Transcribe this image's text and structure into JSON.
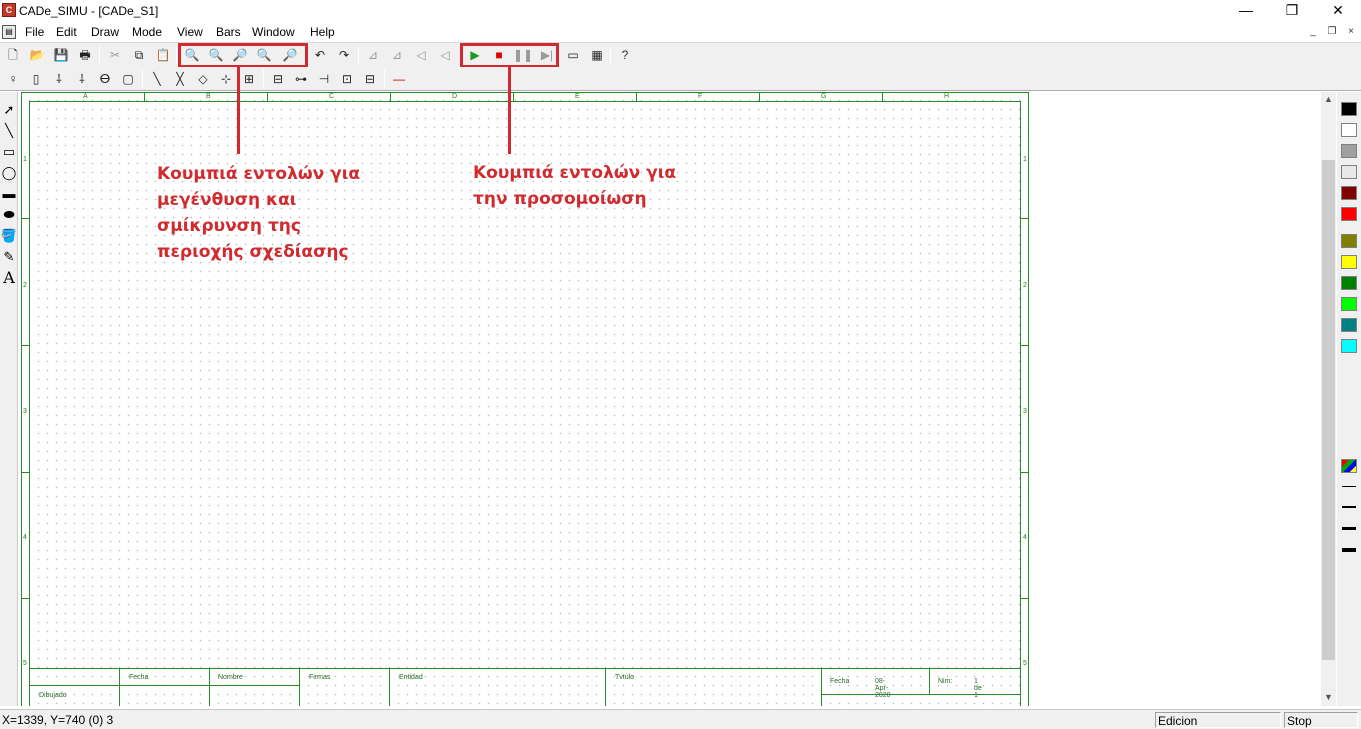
{
  "window": {
    "title": "CADe_SIMU - [CADe_S1]",
    "controls": {
      "minimize": "—",
      "maximize": "❐",
      "close": "✕"
    }
  },
  "menu": {
    "items": [
      "File",
      "Edit",
      "Draw",
      "Mode",
      "View",
      "Bars",
      "Window",
      "Help"
    ],
    "mdi_controls": [
      "_",
      "❐",
      "×"
    ]
  },
  "toolbar_main": {
    "file_buttons": [
      "new-icon",
      "open-icon",
      "save-icon",
      "print-icon"
    ],
    "edit_buttons": [
      "cut-icon",
      "copy-icon",
      "paste-icon"
    ],
    "zoom_buttons": [
      "zoom-in-icon",
      "zoom-out-icon",
      "zoom-window-icon",
      "zoom-all-icon",
      "zoom-previous-icon"
    ],
    "undo_buttons": [
      "undo-icon",
      "redo-icon"
    ],
    "transform_buttons": [
      "rotate-left-icon",
      "rotate-right-icon",
      "mirror-icon",
      "align-icon"
    ],
    "simulation_buttons": [
      "play-icon",
      "stop-icon",
      "pause-icon",
      "step-icon"
    ],
    "extra_buttons": [
      "window-icon",
      "views-icon",
      "help-icon"
    ]
  },
  "annotations": {
    "zoom": "Κουμπιά εντολών για\nμεγένθυση και\nσμίκρυνση της\nπεριοχής σχεδίασης",
    "simulation": "Κουμπιά εντολών για\nτην προσομοίωση",
    "color": "#d12a2f"
  },
  "sheet": {
    "columns": [
      "A",
      "B",
      "C",
      "D",
      "E",
      "F",
      "G",
      "H"
    ],
    "rows": [
      "1",
      "2",
      "3",
      "4",
      "5"
    ],
    "title_block": {
      "fecha_label": "Fecha",
      "nombre_label": "Nombre",
      "firmas_label": "Firmas",
      "entidad_label": "Entidad",
      "titulo_label": "Tvtulo",
      "dibujado_label": "Dibujado",
      "fecha2_label": "Fecha",
      "date_value": "08-Apr-2020",
      "num_label": "Nim:",
      "page_value": "1 de 1"
    }
  },
  "palette": {
    "colors": [
      "#000000",
      "#ffffff",
      "#a0a0a0",
      "#e8e8e8",
      "#800000",
      "#ff0000",
      "#808000",
      "#ffff00",
      "#008000",
      "#00ff00",
      "#008080",
      "#00ffff"
    ]
  },
  "status": {
    "coords": "X=1339, Y=740 (0) 3",
    "mode": "Edicion",
    "sim_state": "Stop"
  }
}
